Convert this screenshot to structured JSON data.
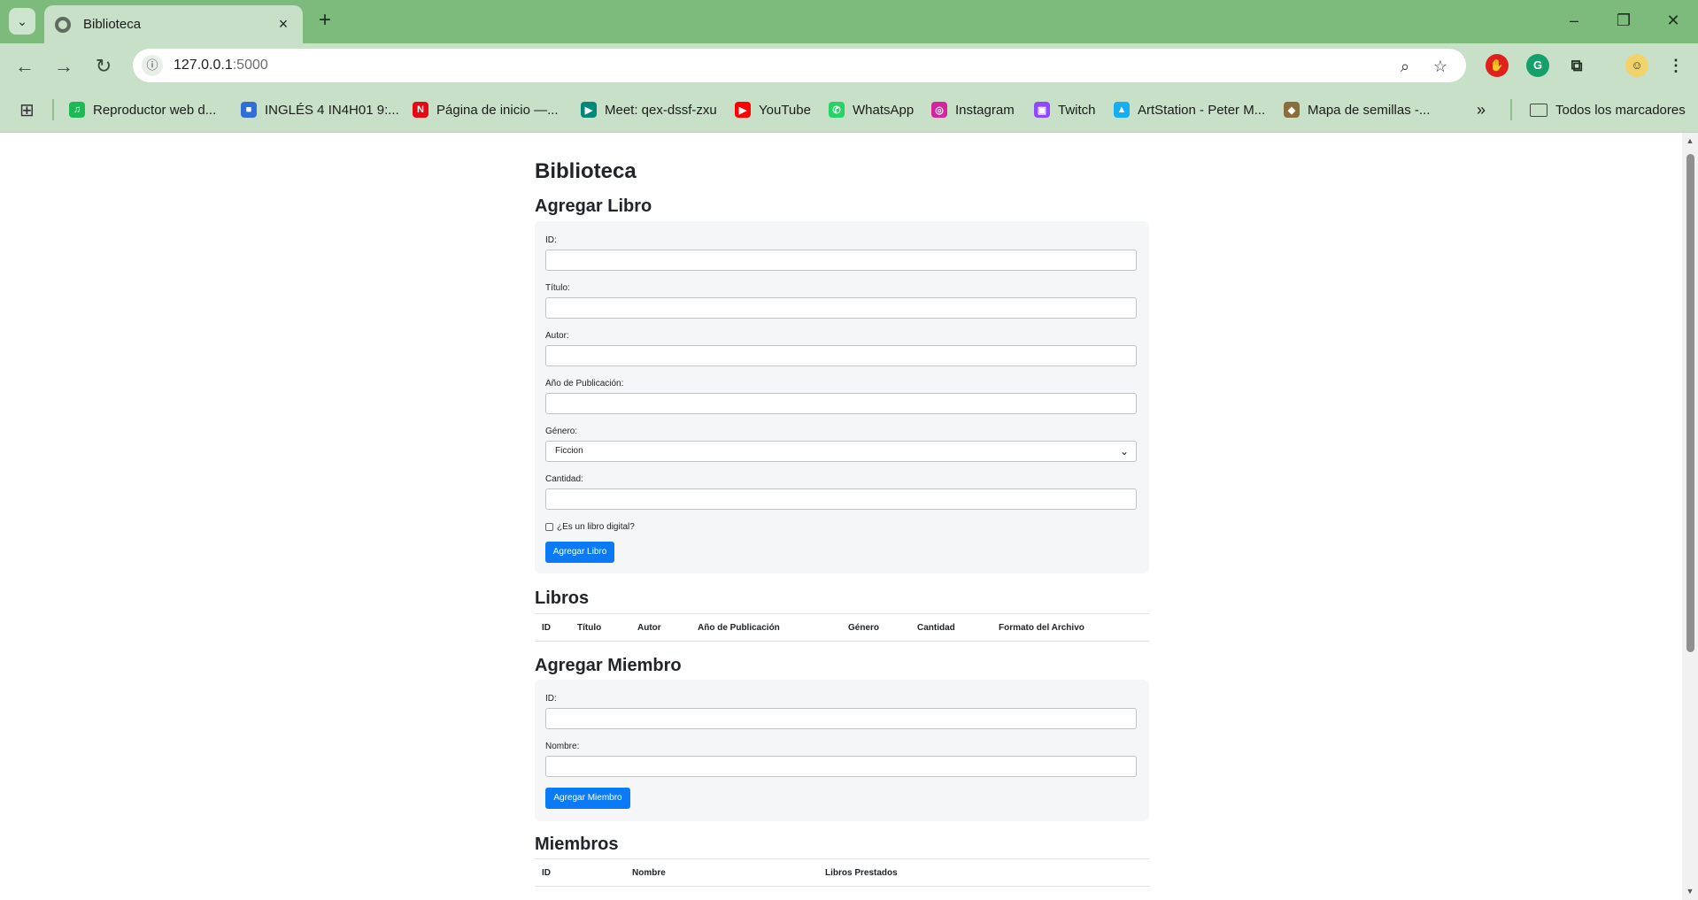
{
  "browser": {
    "tab_title": "Biblioteca",
    "url_host": "127.0.0.1",
    "url_port": ":5000",
    "bookmarks": [
      {
        "label": "Reproductor web d...",
        "icon": "spotify-icon",
        "color": "#1db954"
      },
      {
        "label": "INGLÉS 4 IN4H01 9:...",
        "icon": "classroom-icon",
        "color": "#2f6fd6"
      },
      {
        "label": "Página de inicio —...",
        "icon": "netflix-icon",
        "color": "#e50914"
      },
      {
        "label": "Meet: qex-dssf-zxu",
        "icon": "meet-icon",
        "color": "#00897b"
      },
      {
        "label": "YouTube",
        "icon": "youtube-icon",
        "color": "#ff0000"
      },
      {
        "label": "WhatsApp",
        "icon": "whatsapp-icon",
        "color": "#25d366"
      },
      {
        "label": "Instagram",
        "icon": "instagram-icon",
        "color": "#d6249f"
      },
      {
        "label": "Twitch",
        "icon": "twitch-icon",
        "color": "#9146ff"
      },
      {
        "label": "ArtStation - Peter M...",
        "icon": "artstation-icon",
        "color": "#13aff0"
      },
      {
        "label": "Mapa de semillas -...",
        "icon": "seed-map-icon",
        "color": "#8a6d3b"
      }
    ],
    "all_bookmarks_label": "Todos los marcadores"
  },
  "page": {
    "title": "Biblioteca",
    "add_book": {
      "heading": "Agregar Libro",
      "id_label": "ID:",
      "title_label": "Título:",
      "author_label": "Autor:",
      "year_label": "Año de Publicación:",
      "genre_label": "Género:",
      "genre_selected": "Ficcion",
      "quantity_label": "Cantidad:",
      "digital_label": "¿Es un libro digital?",
      "submit_label": "Agregar Libro"
    },
    "books": {
      "heading": "Libros",
      "columns": [
        "ID",
        "Título",
        "Autor",
        "Año de Publicación",
        "Género",
        "Cantidad",
        "Formato del Archivo"
      ]
    },
    "add_member": {
      "heading": "Agregar Miembro",
      "id_label": "ID:",
      "name_label": "Nombre:",
      "submit_label": "Agregar Miembro"
    },
    "members": {
      "heading": "Miembros",
      "columns": [
        "ID",
        "Nombre",
        "Libros Prestados"
      ]
    }
  },
  "colors": {
    "chrome_frame": "#7cbb7c",
    "chrome_toolbar": "#c8e0c8",
    "primary_button": "#0a7bf5"
  }
}
